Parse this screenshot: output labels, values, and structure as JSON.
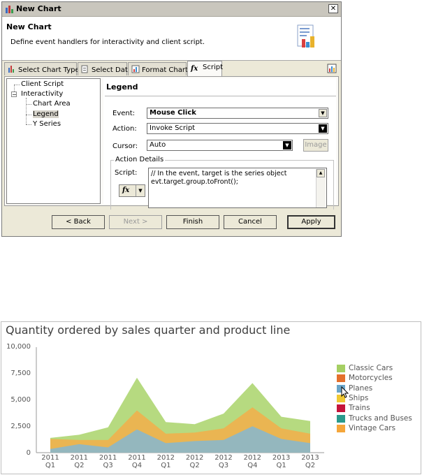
{
  "dialog": {
    "title": "New Chart",
    "heading": "New Chart",
    "description": "Define event handlers for interactivity and client script.",
    "tabs": [
      {
        "label": "Select Chart Type"
      },
      {
        "label": "Select Data"
      },
      {
        "label": "Format Chart"
      },
      {
        "label": "Script"
      }
    ],
    "tree": {
      "items": [
        "Client Script",
        "Interactivity",
        "Chart Area",
        "Legend",
        "Y Series"
      ]
    },
    "panel": {
      "title": "Legend",
      "event_label": "Event:",
      "event_value": "Mouse Click",
      "action_label": "Action:",
      "action_value": "Invoke Script",
      "cursor_label": "Cursor:",
      "cursor_value": "Auto",
      "image_button": "Image",
      "group_title": "Action Details",
      "script_label": "Script:",
      "script_lines": [
        "// In the event, target is the series object",
        "evt.target.group.toFront();"
      ]
    },
    "buttons": {
      "back": "< Back",
      "next": "Next >",
      "finish": "Finish",
      "cancel": "Cancel",
      "apply": "Apply"
    }
  },
  "chart": {
    "title": "Quantity ordered by sales quarter and product line",
    "legend": [
      {
        "name": "Classic Cars",
        "color": "#a5cf63"
      },
      {
        "name": "Motorcycles",
        "color": "#e4702c"
      },
      {
        "name": "Planes",
        "color": "#6aa5c9"
      },
      {
        "name": "Ships",
        "color": "#f0c933"
      },
      {
        "name": "Trains",
        "color": "#c5153b"
      },
      {
        "name": "Trucks and Buses",
        "color": "#2a9a8c"
      },
      {
        "name": "Vintage Cars",
        "color": "#f5a63b"
      }
    ],
    "y_ticks": [
      "10,000",
      "7,500",
      "5,000",
      "2,500",
      "0"
    ],
    "x_ticks": [
      [
        "2011",
        "Q1"
      ],
      [
        "2011",
        "Q2"
      ],
      [
        "2011",
        "Q3"
      ],
      [
        "2011",
        "Q4"
      ],
      [
        "2012",
        "Q1"
      ],
      [
        "2012",
        "Q2"
      ],
      [
        "2012",
        "Q3"
      ],
      [
        "2012",
        "Q4"
      ],
      [
        "2013",
        "Q1"
      ],
      [
        "2013",
        "Q2"
      ]
    ]
  },
  "chart_data": {
    "type": "area",
    "title": "Quantity ordered by sales quarter and product line",
    "x": [
      "2011 Q1",
      "2011 Q2",
      "2011 Q3",
      "2011 Q4",
      "2012 Q1",
      "2012 Q2",
      "2012 Q3",
      "2012 Q4",
      "2013 Q1",
      "2013 Q2"
    ],
    "ylim": [
      0,
      10000
    ],
    "stacked": true,
    "series_visible_layers": [
      {
        "layer": "teal (lower)",
        "cumulative": [
          350,
          800,
          500,
          2200,
          900,
          1100,
          1200,
          2500,
          1300,
          900
        ]
      },
      {
        "layer": "orange (middle)",
        "cumulative": [
          1300,
          1200,
          1200,
          4000,
          1800,
          1900,
          2300,
          4300,
          2300,
          1800
        ]
      },
      {
        "layer": "green (top)",
        "cumulative": [
          1400,
          1700,
          2400,
          7100,
          2900,
          2700,
          3700,
          6600,
          3400,
          3000
        ]
      }
    ],
    "legend_position": "right"
  }
}
